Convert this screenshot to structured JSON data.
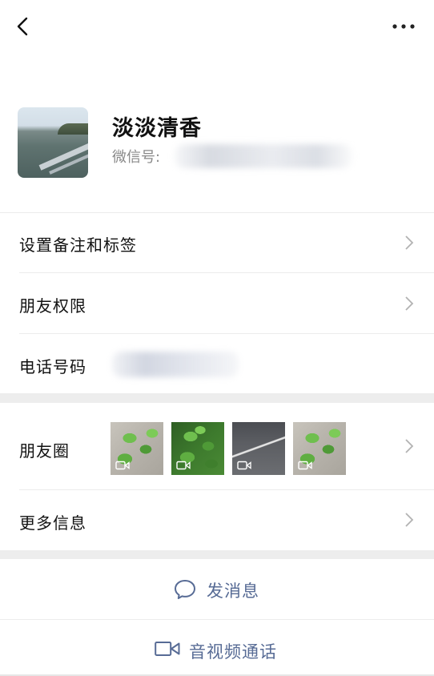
{
  "nav": {
    "back_icon": "chevron-left-icon",
    "more_icon": "ellipsis-icon"
  },
  "profile": {
    "name": "淡淡清香",
    "wechat_id_label": "微信号:"
  },
  "rows": {
    "remark_tags": {
      "label": "设置备注和标签"
    },
    "friend_permissions": {
      "label": "朋友权限"
    },
    "phone": {
      "label": "电话号码"
    },
    "moments": {
      "label": "朋友圈",
      "thumbnail_count": 4
    },
    "more_info": {
      "label": "更多信息"
    }
  },
  "actions": {
    "message": {
      "label": "发消息",
      "icon": "chat-bubble-icon"
    },
    "call": {
      "label": "音视频通话",
      "icon": "video-camera-icon"
    }
  },
  "colors": {
    "action_text": "#576b95",
    "section_gap": "#ededed",
    "divider": "#ececec",
    "chevron": "#b2b2b2"
  }
}
